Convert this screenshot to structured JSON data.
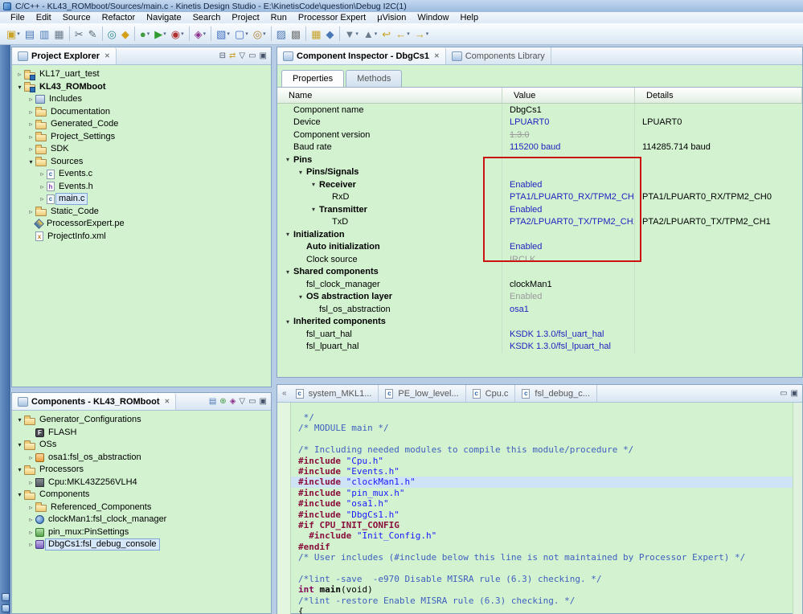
{
  "window": {
    "title": "C/C++ - KL43_ROMboot/Sources/main.c - Kinetis Design Studio - E:\\KinetisCode\\question\\Debug I2C(1)"
  },
  "menu": {
    "items": [
      "File",
      "Edit",
      "Source",
      "Refactor",
      "Navigate",
      "Search",
      "Project",
      "Run",
      "Processor Expert",
      "μVision",
      "Window",
      "Help"
    ]
  },
  "toolbar": {
    "buttons": [
      {
        "name": "new-wizard",
        "glyph": "▣",
        "color": "#c9a227",
        "drop": true
      },
      {
        "name": "save",
        "glyph": "▤",
        "color": "#4a78b5"
      },
      {
        "name": "save-all",
        "glyph": "▥",
        "color": "#4a78b5"
      },
      {
        "name": "print",
        "glyph": "▦",
        "color": "#6a7b8c"
      },
      {
        "sep": true
      },
      {
        "name": "cut-tool",
        "glyph": "✂",
        "color": "#5a6b7c"
      },
      {
        "name": "sketch-tool",
        "glyph": "✎",
        "color": "#5a6b7c"
      },
      {
        "sep": true
      },
      {
        "name": "target-config",
        "glyph": "◎",
        "color": "#2e8b8b"
      },
      {
        "name": "flash-programmer",
        "glyph": "◆",
        "color": "#d4a017"
      },
      {
        "sep": true
      },
      {
        "name": "debug",
        "glyph": "●",
        "color": "#3f9b3f",
        "drop": true
      },
      {
        "name": "run",
        "glyph": "▶",
        "color": "#2e9b2e",
        "drop": true
      },
      {
        "name": "profile",
        "glyph": "◉",
        "color": "#b03030",
        "drop": true
      },
      {
        "sep": true
      },
      {
        "name": "external-tools",
        "glyph": "◈",
        "color": "#8b2e8b",
        "drop": true
      },
      {
        "sep": true
      },
      {
        "name": "new-class",
        "glyph": "▧",
        "color": "#3f6fbf",
        "drop": true
      },
      {
        "name": "new-file",
        "glyph": "▢",
        "color": "#3f6fbf",
        "drop": true
      },
      {
        "name": "search",
        "glyph": "◎",
        "color": "#b08030",
        "drop": true
      },
      {
        "sep": true
      },
      {
        "name": "open-element",
        "glyph": "▨",
        "color": "#4a78b5"
      },
      {
        "name": "toggle-mark-occurrences",
        "glyph": "▩",
        "color": "#7a7a7a"
      },
      {
        "sep": true
      },
      {
        "name": "open-folder",
        "glyph": "▦",
        "color": "#c9a227"
      },
      {
        "name": "pin-editor",
        "glyph": "◆",
        "color": "#4a78b5"
      },
      {
        "sep": true
      },
      {
        "name": "next-annotation",
        "glyph": "▼",
        "color": "#6a7b8c",
        "drop": true
      },
      {
        "name": "prev-annotation",
        "glyph": "▲",
        "color": "#6a7b8c",
        "drop": true
      },
      {
        "name": "last-edit-location",
        "glyph": "↩",
        "color": "#c9a227"
      },
      {
        "name": "back",
        "glyph": "←",
        "color": "#c9a227",
        "drop": true
      },
      {
        "name": "forward",
        "glyph": "→",
        "color": "#c9a227",
        "drop": true
      }
    ]
  },
  "icons": {
    "close": "✕",
    "expanded": "▾",
    "collapsed": "▹",
    "dropdown": "▾",
    "tab_overflow": "«",
    "file_letters": {
      "cfile": "c",
      "hfile": "h",
      "xml": "x",
      "flash": "F"
    }
  },
  "project_explorer": {
    "title": "Project Explorer",
    "tools": [
      {
        "name": "collapse-all",
        "glyph": "⊟",
        "color": "#44536a"
      },
      {
        "name": "link-with-editor",
        "glyph": "⇄",
        "color": "#c9a227"
      },
      {
        "name": "view-menu",
        "glyph": "▽",
        "color": "#44536a"
      },
      {
        "name": "minimize",
        "glyph": "▭",
        "color": "#44536a"
      },
      {
        "name": "maximize",
        "glyph": "▣",
        "color": "#44536a"
      }
    ],
    "items": [
      {
        "label": "KL17_uart_test",
        "depth": 0,
        "icon": "project",
        "state": "collapsed"
      },
      {
        "label": "KL43_ROMboot",
        "depth": 0,
        "icon": "project",
        "state": "expanded",
        "bold": true
      },
      {
        "label": "Includes",
        "depth": 1,
        "icon": "includes",
        "state": "collapsed"
      },
      {
        "label": "Documentation",
        "depth": 1,
        "icon": "folder",
        "state": "collapsed"
      },
      {
        "label": "Generated_Code",
        "depth": 1,
        "icon": "folder",
        "state": "collapsed"
      },
      {
        "label": "Project_Settings",
        "depth": 1,
        "icon": "folder",
        "state": "collapsed"
      },
      {
        "label": "SDK",
        "depth": 1,
        "icon": "folder",
        "state": "collapsed"
      },
      {
        "label": "Sources",
        "depth": 1,
        "icon": "folder",
        "state": "expanded"
      },
      {
        "label": "Events.c",
        "depth": 2,
        "icon": "cfile",
        "state": "collapsed"
      },
      {
        "label": "Events.h",
        "depth": 2,
        "icon": "hfile",
        "state": "collapsed"
      },
      {
        "label": "main.c",
        "depth": 2,
        "icon": "cfile",
        "state": "collapsed",
        "selected": true
      },
      {
        "label": "Static_Code",
        "depth": 1,
        "icon": "folder",
        "state": "collapsed"
      },
      {
        "label": "ProcessorExpert.pe",
        "depth": 1,
        "icon": "pe",
        "state": "none"
      },
      {
        "label": "ProjectInfo.xml",
        "depth": 1,
        "icon": "xml",
        "state": "none"
      }
    ]
  },
  "components_view": {
    "title": "Components - KL43_ROMboot",
    "tools": [
      {
        "name": "filter",
        "glyph": "▤",
        "color": "#4a78b5"
      },
      {
        "name": "add-component",
        "glyph": "⊕",
        "color": "#3f9b3f"
      },
      {
        "name": "options",
        "glyph": "◈",
        "color": "#8b2e8b"
      },
      {
        "name": "view-menu",
        "glyph": "▽",
        "color": "#44536a"
      },
      {
        "name": "minimize",
        "glyph": "▭",
        "color": "#44536a"
      },
      {
        "name": "maximize",
        "glyph": "▣",
        "color": "#44536a"
      }
    ],
    "items": [
      {
        "label": "Generator_Configurations",
        "depth": 0,
        "icon": "folder",
        "state": "expanded"
      },
      {
        "label": "FLASH",
        "depth": 1,
        "icon": "flash",
        "state": "none"
      },
      {
        "label": "OSs",
        "depth": 0,
        "icon": "folder",
        "state": "expanded"
      },
      {
        "label": "osa1:fsl_os_abstraction",
        "depth": 1,
        "icon": "osa",
        "state": "collapsed"
      },
      {
        "label": "Processors",
        "depth": 0,
        "icon": "folder",
        "state": "expanded"
      },
      {
        "label": "Cpu:MKL43Z256VLH4",
        "depth": 1,
        "icon": "cpu",
        "state": "collapsed"
      },
      {
        "label": "Components",
        "depth": 0,
        "icon": "folder",
        "state": "expanded"
      },
      {
        "label": "Referenced_Components",
        "depth": 1,
        "icon": "folder",
        "state": "collapsed"
      },
      {
        "label": "clockMan1:fsl_clock_manager",
        "depth": 1,
        "icon": "clock",
        "state": "collapsed"
      },
      {
        "label": "pin_mux:PinSettings",
        "depth": 1,
        "icon": "pinmux",
        "state": "collapsed"
      },
      {
        "label": "DbgCs1:fsl_debug_console",
        "depth": 1,
        "icon": "dbg",
        "state": "collapsed",
        "selected": true
      }
    ]
  },
  "inspector": {
    "tab_title": "Component Inspector - DbgCs1",
    "tab2_title": "Components Library",
    "subtabs": [
      "Properties",
      "Methods"
    ],
    "columns": [
      "Name",
      "Value",
      "Details"
    ],
    "annotation_color": "#cc1111",
    "rows": [
      {
        "name": "Component name",
        "depth": 0,
        "value": "DbgCs1",
        "vstyle": "plain",
        "details": ""
      },
      {
        "name": "Device",
        "depth": 0,
        "value": "LPUART0",
        "vstyle": "blue",
        "details": "LPUART0"
      },
      {
        "name": "Component version",
        "depth": 0,
        "value": "1.3.0",
        "vstyle": "strike",
        "details": ""
      },
      {
        "name": "Baud rate",
        "depth": 0,
        "value": "115200 baud",
        "vstyle": "blue",
        "details": "114285.714 baud"
      },
      {
        "name": "Pins",
        "depth": 0,
        "group": true,
        "bold": true,
        "value": "",
        "vstyle": "plain",
        "details": ""
      },
      {
        "name": "Pins/Signals",
        "depth": 1,
        "group": true,
        "bold": true,
        "value": "",
        "vstyle": "plain",
        "details": ""
      },
      {
        "name": "Receiver",
        "depth": 2,
        "group": true,
        "bold": true,
        "value": "Enabled",
        "vstyle": "blue",
        "details": ""
      },
      {
        "name": "RxD",
        "depth": 3,
        "value": "PTA1/LPUART0_RX/TPM2_CH0",
        "vstyle": "blue",
        "details": "PTA1/LPUART0_RX/TPM2_CH0"
      },
      {
        "name": "Transmitter",
        "depth": 2,
        "group": true,
        "bold": true,
        "value": "Enabled",
        "vstyle": "blue",
        "details": ""
      },
      {
        "name": "TxD",
        "depth": 3,
        "value": "PTA2/LPUART0_TX/TPM2_CH1",
        "vstyle": "blue",
        "details": "PTA2/LPUART0_TX/TPM2_CH1"
      },
      {
        "name": "Initialization",
        "depth": 0,
        "group": true,
        "bold": true,
        "value": "",
        "vstyle": "plain",
        "details": ""
      },
      {
        "name": "Auto initialization",
        "depth": 1,
        "bold": true,
        "value": "Enabled",
        "vstyle": "blue",
        "details": ""
      },
      {
        "name": "Clock source",
        "depth": 1,
        "value": "IRCLK",
        "vstyle": "gray",
        "details": ""
      },
      {
        "name": "Shared components",
        "depth": 0,
        "group": true,
        "bold": true,
        "value": "",
        "vstyle": "plain",
        "details": ""
      },
      {
        "name": "fsl_clock_manager",
        "depth": 1,
        "value": "clockMan1",
        "vstyle": "plain",
        "details": ""
      },
      {
        "name": "OS abstraction layer",
        "depth": 1,
        "group": true,
        "bold": true,
        "value": "Enabled",
        "vstyle": "gray",
        "details": ""
      },
      {
        "name": "fsl_os_abstraction",
        "depth": 2,
        "value": "osa1",
        "vstyle": "blue",
        "details": ""
      },
      {
        "name": "Inherited components",
        "depth": 0,
        "group": true,
        "bold": true,
        "value": "",
        "vstyle": "plain",
        "details": ""
      },
      {
        "name": "fsl_uart_hal",
        "depth": 1,
        "value": "KSDK 1.3.0/fsl_uart_hal",
        "vstyle": "blue",
        "details": ""
      },
      {
        "name": "fsl_lpuart_hal",
        "depth": 1,
        "value": "KSDK 1.3.0/fsl_lpuart_hal",
        "vstyle": "blue",
        "details": ""
      }
    ]
  },
  "editor": {
    "tabs": [
      {
        "label": "system_MKL1..."
      },
      {
        "label": "PE_low_level..."
      },
      {
        "label": "Cpu.c"
      },
      {
        "label": "fsl_debug_c..."
      }
    ],
    "tools": [
      {
        "name": "minimize",
        "glyph": "▭",
        "color": "#44536a"
      },
      {
        "name": "maximize",
        "glyph": "▣",
        "color": "#44536a"
      }
    ],
    "lines": [
      {
        "segs": [
          [
            "cm",
            " */"
          ]
        ]
      },
      {
        "segs": [
          [
            "cm",
            "/* MODULE main */"
          ]
        ]
      },
      {
        "segs": []
      },
      {
        "segs": [
          [
            "cm",
            "/* Including needed modules to compile this module/procedure */"
          ]
        ]
      },
      {
        "segs": [
          [
            "pp",
            "#include "
          ],
          [
            "str",
            "\"Cpu.h\""
          ]
        ]
      },
      {
        "segs": [
          [
            "pp",
            "#include "
          ],
          [
            "str",
            "\"Events.h\""
          ]
        ]
      },
      {
        "segs": [
          [
            "pp",
            "#include "
          ],
          [
            "str",
            "\"clockMan1.h\""
          ]
        ],
        "hl": true
      },
      {
        "segs": [
          [
            "pp",
            "#include "
          ],
          [
            "str",
            "\"pin_mux.h\""
          ]
        ]
      },
      {
        "segs": [
          [
            "pp",
            "#include "
          ],
          [
            "str",
            "\"osa1.h\""
          ]
        ]
      },
      {
        "segs": [
          [
            "pp",
            "#include "
          ],
          [
            "str",
            "\"DbgCs1.h\""
          ]
        ]
      },
      {
        "segs": [
          [
            "pp",
            "#if CPU_INIT_CONFIG"
          ]
        ]
      },
      {
        "segs": [
          [
            "pp",
            "  #include "
          ],
          [
            "str",
            "\"Init_Config.h\""
          ]
        ]
      },
      {
        "segs": [
          [
            "pp",
            "#endif"
          ]
        ]
      },
      {
        "segs": [
          [
            "cm",
            "/* User includes (#include below this line is not maintained by Processor Expert) */"
          ]
        ]
      },
      {
        "segs": []
      },
      {
        "segs": [
          [
            "cm",
            "/*lint -save  -e970 Disable MISRA rule (6.3) checking. */"
          ]
        ]
      },
      {
        "segs": [
          [
            "kw",
            "int"
          ],
          [
            "b",
            " main"
          ],
          [
            "p",
            "(void)"
          ]
        ]
      },
      {
        "segs": [
          [
            "cm",
            "/*lint -restore Enable MISRA rule (6.3) checking. */"
          ]
        ]
      },
      {
        "segs": [
          [
            "p",
            "{"
          ]
        ]
      }
    ]
  }
}
